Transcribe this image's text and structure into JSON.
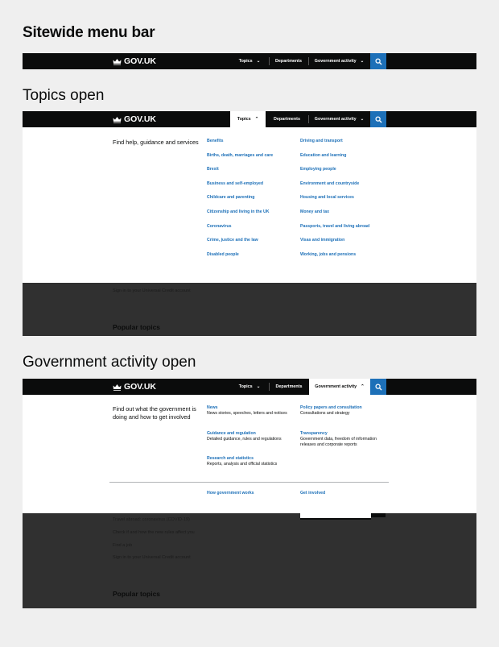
{
  "headings": {
    "sitewide": "Sitewide menu bar",
    "topics_open": "Topics open",
    "gov_open": "Government activity open"
  },
  "header": {
    "logo": "GOV.UK",
    "topics": "Topics",
    "departments": "Departments",
    "government_activity": "Government activity"
  },
  "icons": {
    "logo": "crown-icon",
    "search": "search-icon",
    "chevron_down": "chevron-down-icon",
    "chevron_up": "chevron-up-icon"
  },
  "colors": {
    "header_bg": "#0b0c0c",
    "link": "#1d70b8",
    "search_bg": "#1d70b8",
    "overlay": "#303030",
    "page_bg": "#efefef"
  },
  "topics_panel": {
    "lead": "Find help, guidance and services",
    "links": [
      "Benefits",
      "Births, death, marriages and care",
      "Brexit",
      "Business and self-employed",
      "Childcare and parenting",
      "Citizenship and living in the UK",
      "Coronavirus",
      "Crime, justice and the law",
      "Disabled people",
      "Driving and transport",
      "Education and learning",
      "Employing people",
      "Environment and countryside",
      "Housing and local services",
      "Money and tax",
      "Passports, travel and living abroad",
      "Visas and immigration",
      "Working, jobs and pensions"
    ]
  },
  "topics_underlay": {
    "link": "Sign in to your Universal Credit account",
    "popular": "Popular topics"
  },
  "gov_panel": {
    "lead": "Find out what the government is doing and how to get involved",
    "items": [
      {
        "title": "News",
        "desc": "News stories, speeches, letters and notices"
      },
      {
        "title": "Guidance and regulation",
        "desc": "Detailed guidance, rules and regulations"
      },
      {
        "title": "Research and statistics",
        "desc": "Reports, analysis and official statistics"
      },
      {
        "title": "Policy papers and consultation",
        "desc": "Consultations and strategy"
      },
      {
        "title": "Transparency",
        "desc": "Government data, freedom of information releases and corporate reports"
      }
    ],
    "footer_links": [
      "How government works",
      "Get involved"
    ]
  },
  "gov_underlay": {
    "links": [
      "Travel abroad: coronavirus (COVID-19)",
      "Check if and how the new rules affect you",
      "Find a job",
      "Sign in to your Universal Credit account"
    ],
    "popular": "Popular topics"
  }
}
